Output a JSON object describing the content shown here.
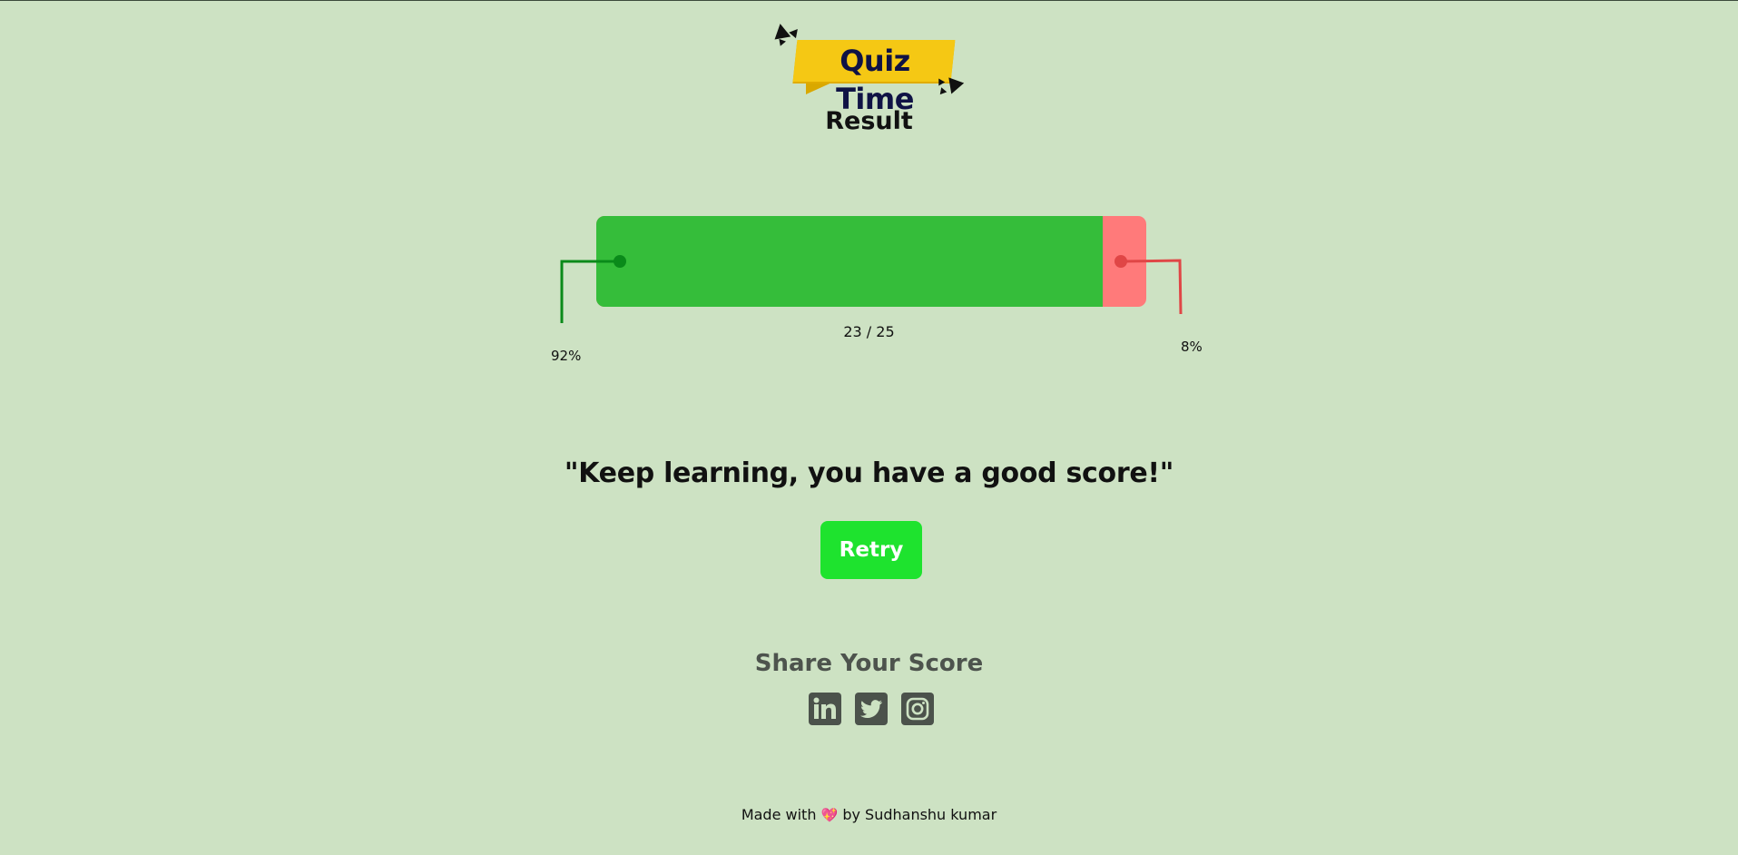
{
  "header": {
    "logo_text": "Quiz Time",
    "title": "Result"
  },
  "result": {
    "score_text": "23 / 25",
    "correct_fraction": 0.92,
    "correct_percent_label": "92%",
    "wrong_percent_label": "8%",
    "message": "\"Keep learning, you have a good score!\"",
    "retry_label": "Retry"
  },
  "colors": {
    "background": "#cde2c3",
    "correct": "#35bd3a",
    "wrong": "#ff7a7a",
    "correct_line": "#0a8a1a",
    "wrong_line": "#e04646",
    "retry": "#1ee32e",
    "logo_banner": "#f5c814"
  },
  "share": {
    "title": "Share Your Score",
    "icons": [
      "linkedin-icon",
      "twitter-icon",
      "instagram-icon"
    ]
  },
  "footer": {
    "prefix": "Made with",
    "heart": "💖",
    "suffix": "by Sudhanshu kumar"
  }
}
